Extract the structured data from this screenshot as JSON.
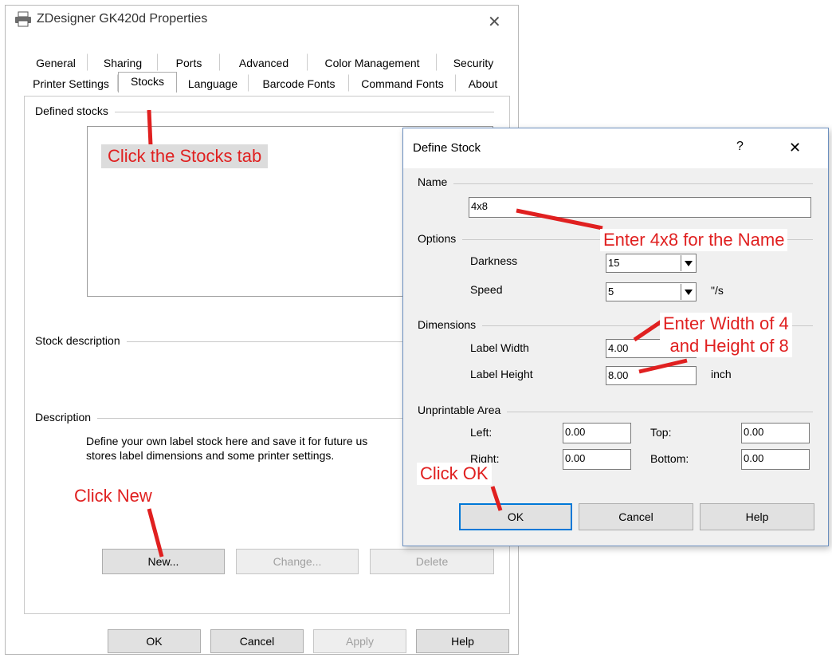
{
  "main_window": {
    "title": "ZDesigner GK420d Properties",
    "close_glyph": "✕",
    "tabs_row1": [
      "General",
      "Sharing",
      "Ports",
      "Advanced",
      "Color Management",
      "Security"
    ],
    "tabs_row2": [
      "Printer Settings",
      "Stocks",
      "Language",
      "Barcode Fonts",
      "Command Fonts",
      "About"
    ],
    "active_tab": "Stocks",
    "defined_stocks_label": "Defined stocks",
    "stock_description_label": "Stock description",
    "description_label": "Description",
    "description_text_line1": "Define your own label stock here and save it for future us",
    "description_text_line2": "stores label dimensions and some printer settings.",
    "buttons": {
      "new": "New...",
      "change": "Change...",
      "delete": "Delete"
    },
    "footer_buttons": {
      "ok": "OK",
      "cancel": "Cancel",
      "apply": "Apply",
      "help": "Help"
    }
  },
  "dialog": {
    "title": "Define Stock",
    "help_glyph": "?",
    "close_glyph": "✕",
    "name_group": "Name",
    "name_value": "4x8",
    "options_group": "Options",
    "darkness_label": "Darkness",
    "darkness_value": "15",
    "speed_label": "Speed",
    "speed_value": "5",
    "speed_unit": "\"/s",
    "dimensions_group": "Dimensions",
    "label_width_label": "Label Width",
    "label_width_value": "4.00",
    "label_height_label": "Label Height",
    "label_height_value": "8.00",
    "dimension_unit": "inch",
    "unprintable_group": "Unprintable Area",
    "left_label": "Left:",
    "left_value": "0.00",
    "top_label": "Top:",
    "top_value": "0.00",
    "right_label": "Right:",
    "right_value": "0.00",
    "bottom_label": "Bottom:",
    "bottom_value": "0.00",
    "buttons": {
      "ok": "OK",
      "cancel": "Cancel",
      "help": "Help"
    }
  },
  "annotations": {
    "stocks_tab": "Click the Stocks tab",
    "new": "Click New",
    "name": "Enter 4x8 for the Name",
    "dims_line1": "Enter Width of 4",
    "dims_line2": "and Height of 8",
    "ok": "Click OK"
  },
  "colors": {
    "annotation": "#e02020",
    "accent": "#0078d7"
  }
}
